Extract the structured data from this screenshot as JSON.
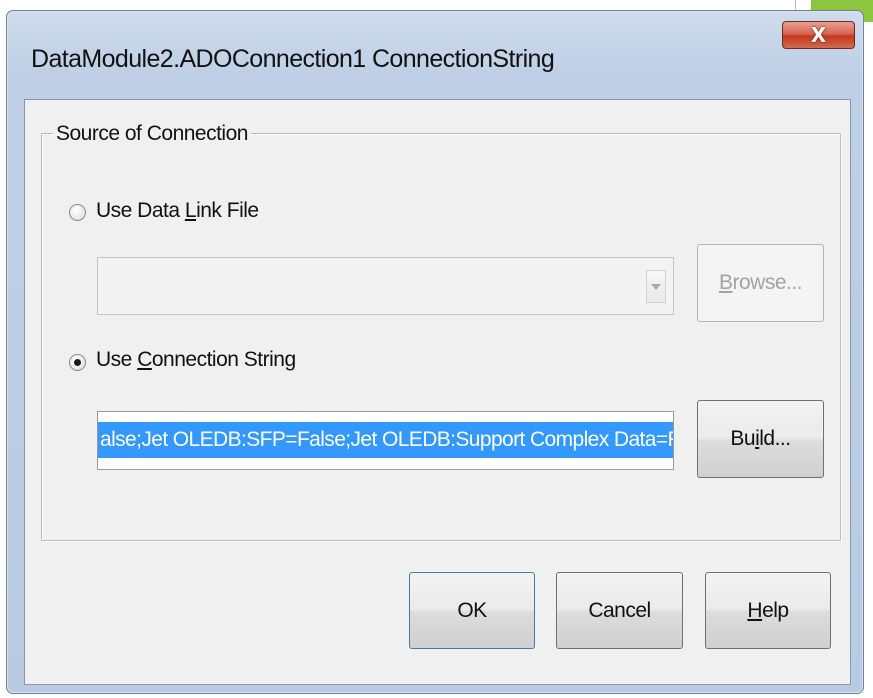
{
  "dialog": {
    "title": "DataModule2.ADOConnection1 ConnectionString",
    "close_icon": "close-x-icon",
    "close_glyph": "X"
  },
  "source_group": {
    "legend": "Source of Connection",
    "data_link_file": {
      "label_before": "Use Data ",
      "label_accel": "L",
      "label_after": "ink File",
      "selected": false,
      "file_value": "",
      "browse_button": {
        "label_accel": "B",
        "label_after": "rowse...",
        "enabled": false
      }
    },
    "connection_string": {
      "label_before": "Use ",
      "label_accel": "C",
      "label_after": "onnection String",
      "selected": true,
      "value": "alse;Jet OLEDB:SFP=False;Jet OLEDB:Support Complex Data=False;",
      "build_button": {
        "label_before": "Bu",
        "label_accel": "i",
        "label_after": "ld..."
      }
    }
  },
  "footer_buttons": {
    "ok": "OK",
    "cancel": "Cancel",
    "help_accel": "H",
    "help_after": "elp"
  },
  "colors": {
    "selection_bg": "#3399ff",
    "title_bar": "#bfd0e6",
    "close_button": "#c2381f",
    "accent_green": "#8cc63f"
  }
}
